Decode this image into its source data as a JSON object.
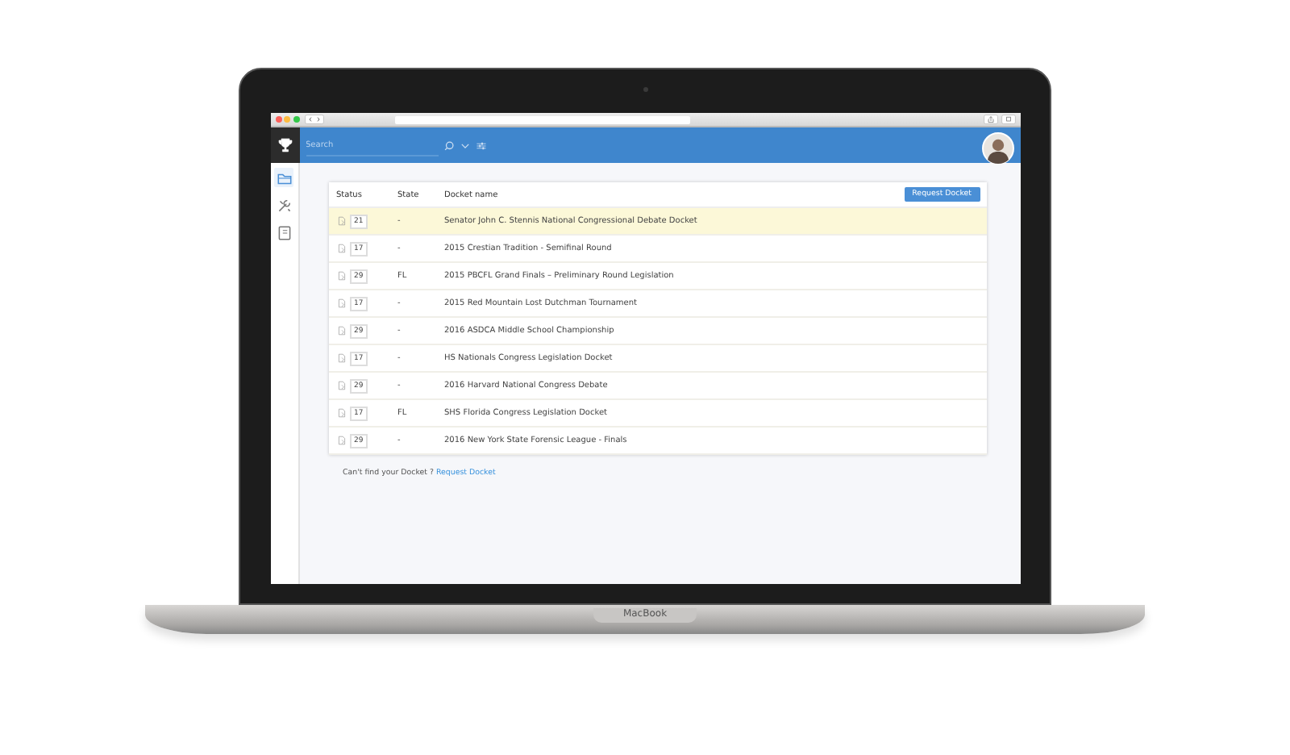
{
  "app_bar": {
    "search": {
      "placeholder": "Search"
    }
  },
  "sidebar": {
    "items": [
      {
        "kind": "folder",
        "selected": true
      },
      {
        "kind": "tools",
        "selected": false
      },
      {
        "kind": "book",
        "selected": false
      }
    ]
  },
  "table": {
    "columns": [
      "Status",
      "State",
      "Docket name"
    ],
    "button": "Request Docket",
    "rows": [
      {
        "count": "21",
        "state": "-",
        "name": "Senator John C. Stennis National Congressional Debate  Docket",
        "selected": true
      },
      {
        "count": "17",
        "state": "-",
        "name": "2015 Crestian Tradition - Semifinal Round",
        "selected": false
      },
      {
        "count": "29",
        "state": "FL",
        "name": "2015 PBCFL Grand Finals – Preliminary Round Legislation",
        "selected": false
      },
      {
        "count": "17",
        "state": "-",
        "name": "2015 Red Mountain Lost Dutchman Tournament",
        "selected": false
      },
      {
        "count": "29",
        "state": "-",
        "name": "2016 ASDCA Middle School Championship",
        "selected": false
      },
      {
        "count": "17",
        "state": "-",
        "name": "HS Nationals Congress Legislation Docket",
        "selected": false
      },
      {
        "count": "29",
        "state": "-",
        "name": "2016 Harvard National Congress Debate",
        "selected": false
      },
      {
        "count": "17",
        "state": "FL",
        "name": "SHS Florida Congress Legislation Docket",
        "selected": false
      },
      {
        "count": "29",
        "state": "-",
        "name": "2016 New York State Forensic League - Finals",
        "selected": false
      }
    ]
  },
  "footer": {
    "text": "Can't find your Docket ?",
    "link": "Request Docket"
  },
  "laptop": {
    "label": "MacBook"
  }
}
